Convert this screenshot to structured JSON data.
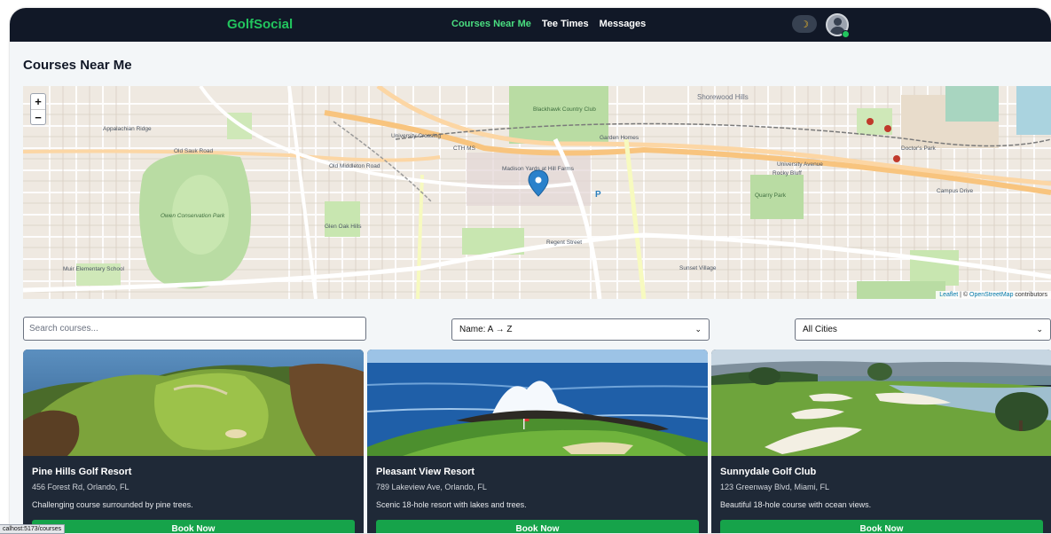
{
  "navbar": {
    "brand": "GolfSocial",
    "links": [
      "Courses Near Me",
      "Tee Times",
      "Messages"
    ],
    "theme_icon": "moon-icon"
  },
  "page": {
    "title": "Courses Near Me"
  },
  "map": {
    "zoom_in": "+",
    "zoom_out": "−",
    "attribution_leaflet": "Leaflet",
    "attribution_sep": " | © ",
    "attribution_osm": "OpenStreetMap",
    "attribution_tail": " contributors",
    "labels": {
      "appalachian": "Appalachian Ridge",
      "owen": "Owen Conservation Park",
      "blackhawk": "Blackhawk Country Club",
      "university": "University Crossing",
      "madison": "Madison Yards at Hill Farms",
      "garden": "Garden Homes",
      "shorewood": "Shorewood Hills",
      "cth": "CTH MS",
      "university_ave": "University Avenue",
      "campus": "Campus Drive",
      "old_sauk": "Old Sauk Road",
      "old_middleton": "Old Middleton Road",
      "regent": "Regent Street",
      "muir": "Muir Elementary School",
      "glen": "Glen Oak Hills",
      "doctors": "Doctor's Park",
      "sunset": "Sunset Village",
      "quarry": "Quarry Park",
      "rocky": "Rocky Bluff"
    }
  },
  "controls": {
    "search_placeholder": "Search courses...",
    "sort_selected": "Name: A → Z",
    "city_selected": "All Cities"
  },
  "courses": [
    {
      "name": "Pine Hills Golf Resort",
      "address": "456 Forest Rd, Orlando, FL",
      "description": "Challenging course surrounded by pine trees.",
      "button": "Book Now"
    },
    {
      "name": "Pleasant View Resort",
      "address": "789 Lakeview Ave, Orlando, FL",
      "description": "Scenic 18-hole resort with lakes and trees.",
      "button": "Book Now"
    },
    {
      "name": "Sunnydale Golf Club",
      "address": "123 Greenway Blvd, Miami, FL",
      "description": "Beautiful 18-hole course with ocean views.",
      "button": "Book Now"
    }
  ],
  "status_bar": {
    "url": "calhost:5173/courses"
  },
  "colors": {
    "accent": "#22c55e",
    "nav_bg": "#111827",
    "card_bg": "#1f2937",
    "button": "#16a34a"
  }
}
